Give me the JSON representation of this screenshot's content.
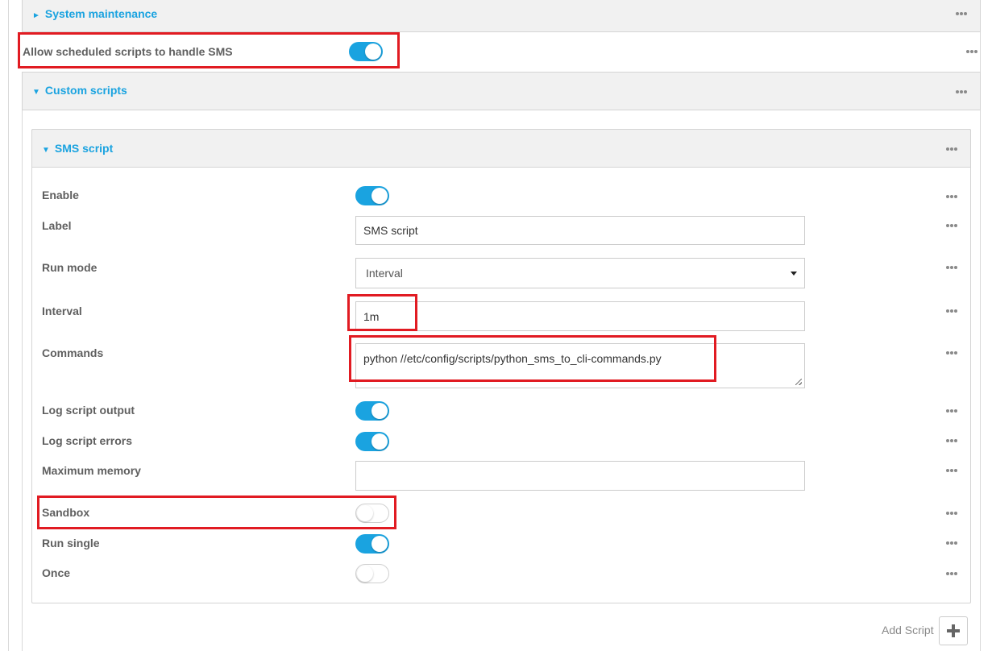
{
  "system_maintenance": {
    "caret": "►",
    "title": "System maintenance"
  },
  "allow_sms": {
    "label": "Allow scheduled scripts to handle SMS",
    "enabled": true
  },
  "custom_scripts": {
    "caret": "▼",
    "title": "Custom scripts"
  },
  "sms_script": {
    "caret": "▼",
    "title": "SMS script",
    "enable": {
      "label": "Enable",
      "value": true
    },
    "label_field": {
      "label": "Label",
      "value": "SMS script"
    },
    "run_mode": {
      "label": "Run mode",
      "value": "Interval"
    },
    "interval": {
      "label": "Interval",
      "value": "1m"
    },
    "commands": {
      "label": "Commands",
      "value": "python //etc/config/scripts/python_sms_to_cli-commands.py"
    },
    "log_output": {
      "label": "Log script output",
      "value": true
    },
    "log_errors": {
      "label": "Log script errors",
      "value": true
    },
    "max_memory": {
      "label": "Maximum memory",
      "value": ""
    },
    "sandbox": {
      "label": "Sandbox",
      "value": false
    },
    "run_single": {
      "label": "Run single",
      "value": true
    },
    "once": {
      "label": "Once",
      "value": false
    }
  },
  "add_script": {
    "label": "Add Script"
  },
  "colors": {
    "accent": "#1aa3e0",
    "highlight": "#e11b22"
  },
  "icons": {
    "more": "more-dots-icon",
    "add": "plus-icon"
  }
}
